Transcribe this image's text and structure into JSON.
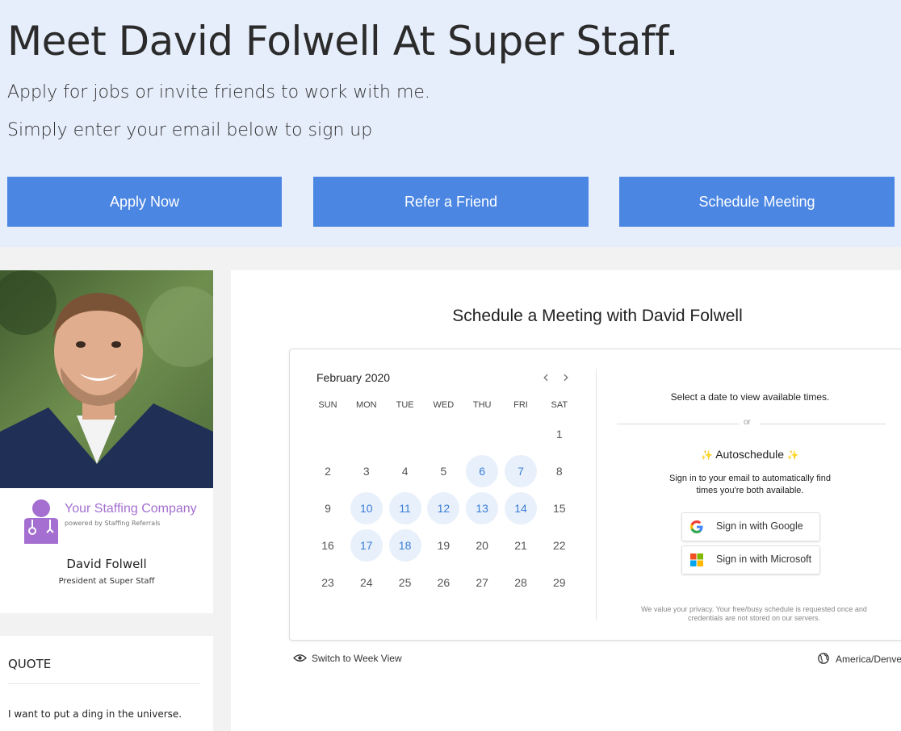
{
  "hero": {
    "title": "Meet David Folwell At Super Staff.",
    "subtitle1": "Apply for jobs or invite friends to work with me.",
    "subtitle2": "Simply enter your email below to sign up",
    "buttons": [
      "Apply Now",
      "Refer a Friend",
      "Schedule Meeting"
    ],
    "button_color": "#4b86e3",
    "background": "#e6eefb"
  },
  "profile": {
    "company_name": "Your Staffing Company",
    "company_tagline": "powered by Staffing Referrals",
    "name": "David Folwell",
    "title": "President at Super Staff",
    "brand_color": "#a46fd0"
  },
  "quote": {
    "heading": "QUOTE",
    "text": "I want to put a ding in the universe."
  },
  "scheduler": {
    "heading": "Schedule a Meeting with David Folwell",
    "month": "February 2020",
    "weekdays": [
      "SUN",
      "MON",
      "TUE",
      "WED",
      "THU",
      "FRI",
      "SAT"
    ],
    "weeks": [
      [
        "",
        "",
        "",
        "",
        "",
        "",
        "1"
      ],
      [
        "2",
        "3",
        "4",
        "5",
        "6",
        "7",
        "8"
      ],
      [
        "9",
        "10",
        "11",
        "12",
        "13",
        "14",
        "15"
      ],
      [
        "16",
        "17",
        "18",
        "19",
        "20",
        "21",
        "22"
      ],
      [
        "23",
        "24",
        "25",
        "26",
        "27",
        "28",
        "29"
      ]
    ],
    "available_days": [
      "6",
      "7",
      "10",
      "11",
      "12",
      "13",
      "14",
      "17",
      "18"
    ],
    "select_prompt": "Select a date to view available times.",
    "or_label": "or",
    "autoschedule_title": "Autoschedule",
    "autoschedule_desc_line1": "Sign in to your email to automatically find",
    "autoschedule_desc_line2": "times you're both available.",
    "google_button": "Sign in with Google",
    "microsoft_button": "Sign in with Microsoft",
    "privacy_line1": "We value your privacy. Your free/busy schedule is requested once and",
    "privacy_line2": "credentials are not stored on our servers.",
    "week_view_link": "Switch to Week View",
    "timezone": "America/Denve",
    "accent_color": "#3b7ed7"
  }
}
